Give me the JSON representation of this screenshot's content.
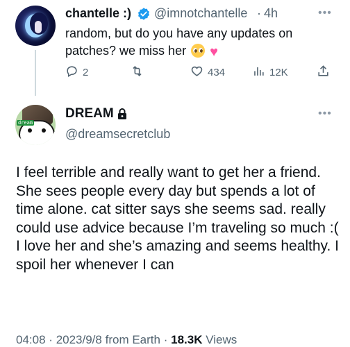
{
  "reply_tweet": {
    "display_name": "chantelle :)",
    "handle": "@imnotchantelle",
    "separator": "·",
    "time": "4h",
    "text": "random, but do you have any updates on patches? we miss her",
    "emojis": [
      "pleading-face",
      "pink-heart"
    ],
    "stats": {
      "replies": "2",
      "retweets": "",
      "likes": "434",
      "views": "12K"
    },
    "verified": true
  },
  "main_tweet": {
    "display_name": "DREAM",
    "handle": "@dreamsecretclub",
    "avatar_tag": "dream",
    "protected": true,
    "text": "I feel terrible and really want to get her a friend. She sees people every day but spends a lot of time alone. cat sitter says she seems sad. really could use advice because I’m traveling so much :( I love her and she’s amazing and seems healthy. I spoil her whenever I can",
    "time": "04:08",
    "date": "2023/9/8",
    "source": "from Earth",
    "separator": "·",
    "views_count": "18.3K",
    "views_label": "Views"
  },
  "colors": {
    "text": "#0f1419",
    "secondary": "#536471",
    "verified": "#1d9bf0",
    "heart_emoji": "#ff4fa0",
    "thread_line": "#cfd9de"
  }
}
